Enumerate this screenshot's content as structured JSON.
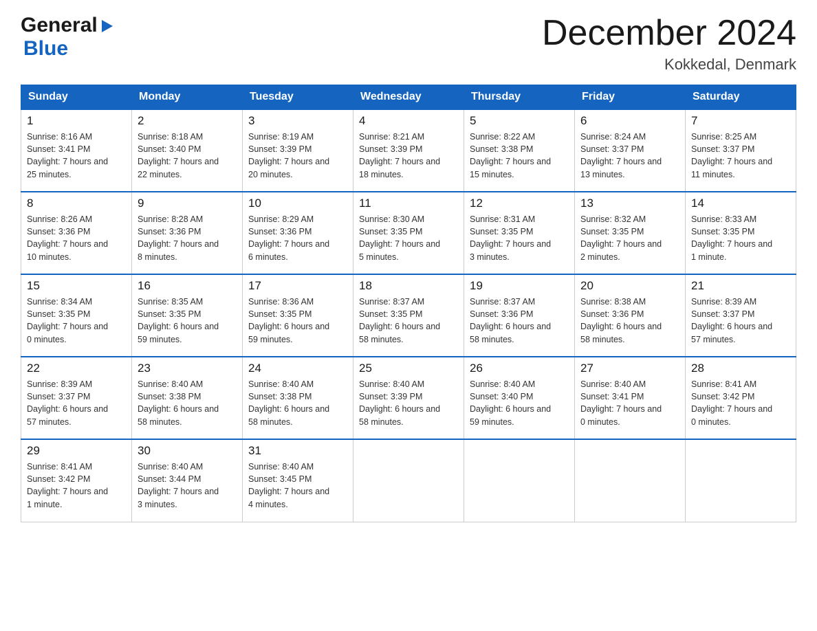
{
  "header": {
    "logo_line1": "General",
    "logo_line2": "Blue",
    "title": "December 2024",
    "subtitle": "Kokkedal, Denmark"
  },
  "days_of_week": [
    "Sunday",
    "Monday",
    "Tuesday",
    "Wednesday",
    "Thursday",
    "Friday",
    "Saturday"
  ],
  "weeks": [
    [
      {
        "day": "1",
        "sunrise": "8:16 AM",
        "sunset": "3:41 PM",
        "daylight": "7 hours and 25 minutes."
      },
      {
        "day": "2",
        "sunrise": "8:18 AM",
        "sunset": "3:40 PM",
        "daylight": "7 hours and 22 minutes."
      },
      {
        "day": "3",
        "sunrise": "8:19 AM",
        "sunset": "3:39 PM",
        "daylight": "7 hours and 20 minutes."
      },
      {
        "day": "4",
        "sunrise": "8:21 AM",
        "sunset": "3:39 PM",
        "daylight": "7 hours and 18 minutes."
      },
      {
        "day": "5",
        "sunrise": "8:22 AM",
        "sunset": "3:38 PM",
        "daylight": "7 hours and 15 minutes."
      },
      {
        "day": "6",
        "sunrise": "8:24 AM",
        "sunset": "3:37 PM",
        "daylight": "7 hours and 13 minutes."
      },
      {
        "day": "7",
        "sunrise": "8:25 AM",
        "sunset": "3:37 PM",
        "daylight": "7 hours and 11 minutes."
      }
    ],
    [
      {
        "day": "8",
        "sunrise": "8:26 AM",
        "sunset": "3:36 PM",
        "daylight": "7 hours and 10 minutes."
      },
      {
        "day": "9",
        "sunrise": "8:28 AM",
        "sunset": "3:36 PM",
        "daylight": "7 hours and 8 minutes."
      },
      {
        "day": "10",
        "sunrise": "8:29 AM",
        "sunset": "3:36 PM",
        "daylight": "7 hours and 6 minutes."
      },
      {
        "day": "11",
        "sunrise": "8:30 AM",
        "sunset": "3:35 PM",
        "daylight": "7 hours and 5 minutes."
      },
      {
        "day": "12",
        "sunrise": "8:31 AM",
        "sunset": "3:35 PM",
        "daylight": "7 hours and 3 minutes."
      },
      {
        "day": "13",
        "sunrise": "8:32 AM",
        "sunset": "3:35 PM",
        "daylight": "7 hours and 2 minutes."
      },
      {
        "day": "14",
        "sunrise": "8:33 AM",
        "sunset": "3:35 PM",
        "daylight": "7 hours and 1 minute."
      }
    ],
    [
      {
        "day": "15",
        "sunrise": "8:34 AM",
        "sunset": "3:35 PM",
        "daylight": "7 hours and 0 minutes."
      },
      {
        "day": "16",
        "sunrise": "8:35 AM",
        "sunset": "3:35 PM",
        "daylight": "6 hours and 59 minutes."
      },
      {
        "day": "17",
        "sunrise": "8:36 AM",
        "sunset": "3:35 PM",
        "daylight": "6 hours and 59 minutes."
      },
      {
        "day": "18",
        "sunrise": "8:37 AM",
        "sunset": "3:35 PM",
        "daylight": "6 hours and 58 minutes."
      },
      {
        "day": "19",
        "sunrise": "8:37 AM",
        "sunset": "3:36 PM",
        "daylight": "6 hours and 58 minutes."
      },
      {
        "day": "20",
        "sunrise": "8:38 AM",
        "sunset": "3:36 PM",
        "daylight": "6 hours and 58 minutes."
      },
      {
        "day": "21",
        "sunrise": "8:39 AM",
        "sunset": "3:37 PM",
        "daylight": "6 hours and 57 minutes."
      }
    ],
    [
      {
        "day": "22",
        "sunrise": "8:39 AM",
        "sunset": "3:37 PM",
        "daylight": "6 hours and 57 minutes."
      },
      {
        "day": "23",
        "sunrise": "8:40 AM",
        "sunset": "3:38 PM",
        "daylight": "6 hours and 58 minutes."
      },
      {
        "day": "24",
        "sunrise": "8:40 AM",
        "sunset": "3:38 PM",
        "daylight": "6 hours and 58 minutes."
      },
      {
        "day": "25",
        "sunrise": "8:40 AM",
        "sunset": "3:39 PM",
        "daylight": "6 hours and 58 minutes."
      },
      {
        "day": "26",
        "sunrise": "8:40 AM",
        "sunset": "3:40 PM",
        "daylight": "6 hours and 59 minutes."
      },
      {
        "day": "27",
        "sunrise": "8:40 AM",
        "sunset": "3:41 PM",
        "daylight": "7 hours and 0 minutes."
      },
      {
        "day": "28",
        "sunrise": "8:41 AM",
        "sunset": "3:42 PM",
        "daylight": "7 hours and 0 minutes."
      }
    ],
    [
      {
        "day": "29",
        "sunrise": "8:41 AM",
        "sunset": "3:42 PM",
        "daylight": "7 hours and 1 minute."
      },
      {
        "day": "30",
        "sunrise": "8:40 AM",
        "sunset": "3:44 PM",
        "daylight": "7 hours and 3 minutes."
      },
      {
        "day": "31",
        "sunrise": "8:40 AM",
        "sunset": "3:45 PM",
        "daylight": "7 hours and 4 minutes."
      },
      null,
      null,
      null,
      null
    ]
  ],
  "labels": {
    "sunrise": "Sunrise:",
    "sunset": "Sunset:",
    "daylight": "Daylight:"
  }
}
